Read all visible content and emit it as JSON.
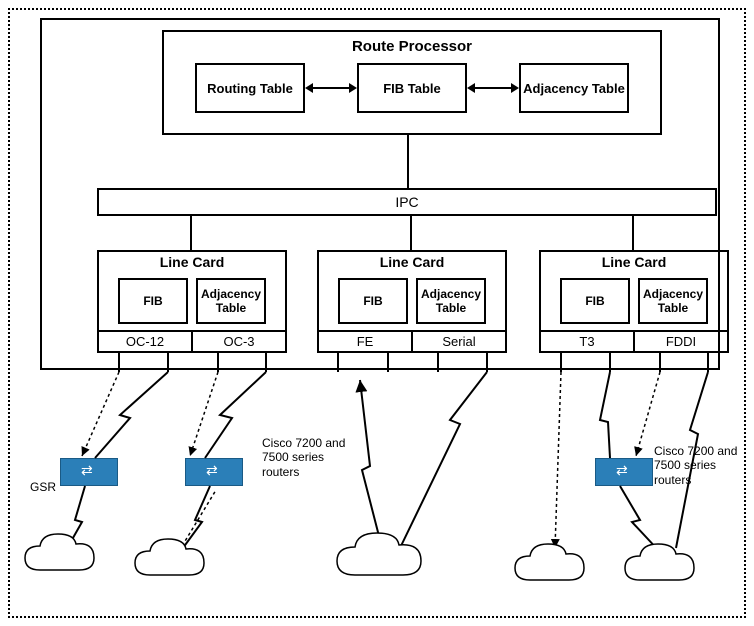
{
  "route_processor": {
    "title": "Route Processor",
    "cells": [
      "Routing Table",
      "FIB Table",
      "Adjacency Table"
    ]
  },
  "ipc": {
    "label": "IPC"
  },
  "line_cards": [
    {
      "title": "Line Card",
      "fib": "FIB",
      "adj": "Adjacency Table",
      "ports": [
        "OC-12",
        "OC-3"
      ]
    },
    {
      "title": "Line Card",
      "fib": "FIB",
      "adj": "Adjacency Table",
      "ports": [
        "FE",
        "Serial"
      ]
    },
    {
      "title": "Line Card",
      "fib": "FIB",
      "adj": "Adjacency Table",
      "ports": [
        "T3",
        "FDDI"
      ]
    }
  ],
  "labels": {
    "gsr": "GSR",
    "cisco": "Cisco 7200 and 7500 series routers"
  }
}
